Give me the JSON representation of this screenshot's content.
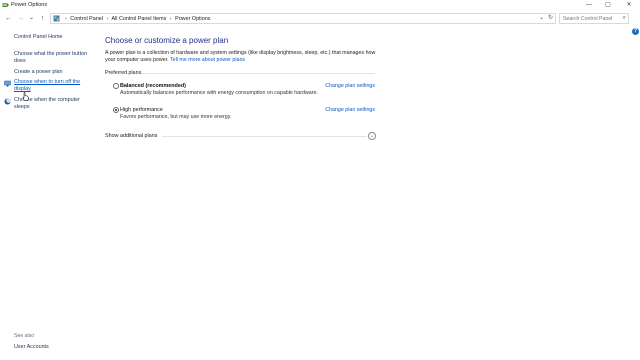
{
  "window": {
    "title": "Power Options",
    "controls": {
      "minimize": "—",
      "maximize": "▢",
      "close": "✕"
    }
  },
  "nav": {
    "back": "←",
    "forward": "→",
    "recent": "⌄",
    "up": "↑"
  },
  "address": {
    "crumbs": [
      "Control Panel",
      "All Control Panel Items",
      "Power Options"
    ],
    "separator": "›",
    "dropdown": "⌄",
    "refresh": "↻"
  },
  "search": {
    "placeholder": "Search Control Panel",
    "icon_glyph": "⌕"
  },
  "help": {
    "glyph": "?"
  },
  "sidebar": {
    "home": "Control Panel Home",
    "items": [
      "Choose what the power button does",
      "Create a power plan",
      "Choose when to turn off the display",
      "Choose when the computer sleeps"
    ],
    "see_also": "See also",
    "user_accounts": "User Accounts"
  },
  "main": {
    "title": "Choose or customize a power plan",
    "description": "A power plan is a collection of hardware and system settings (like display brightness, sleep, etc.) that manages how your computer uses power.",
    "description_link": "Tell me more about power plans",
    "group_label": "Preferred plans",
    "plans": [
      {
        "name": "Balanced (recommended)",
        "description": "Automatically balances performance with energy consumption on capable hardware.",
        "link": "Change plan settings",
        "selected": false
      },
      {
        "name": "High performance",
        "description": "Favors performance, but may use more energy.",
        "link": "Change plan settings",
        "selected": true
      }
    ],
    "show_additional": "Show additional plans",
    "expand_glyph": "⌄"
  },
  "colors": {
    "title_blue": "#1e3287",
    "link_blue": "#0a58c2",
    "nav_link": "#1e3966"
  }
}
